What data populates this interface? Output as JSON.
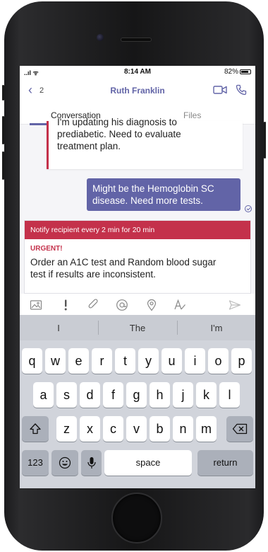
{
  "status_bar": {
    "signal": "..ıl ᯤ",
    "time": "8:14 AM",
    "battery": "82%"
  },
  "header": {
    "back_arrow": "‹",
    "back_count": "2",
    "title": "Ruth Franklin",
    "video_icon": "video-camera-icon",
    "call_icon": "phone-icon"
  },
  "tabs": [
    {
      "label": "Conversation",
      "active": true
    },
    {
      "label": "Files",
      "active": false
    }
  ],
  "messages": [
    {
      "lines": [
        "I'm updating his diagnosis to",
        "prediabetic. Need to evaluate",
        "treatment plan."
      ],
      "incoming": true
    },
    {
      "lines": [
        "Might be the Hemoglobin SC",
        "disease. Need more tests."
      ],
      "incoming": false
    }
  ],
  "compose": {
    "notify_text": "Notify recipient every 2 min for 20 min",
    "urgent_label": "URGENT!",
    "lines": [
      "Order an A1C test and Random blood sugar",
      "test if results are inconsistent."
    ]
  },
  "toolbar_icons": [
    "image-icon",
    "exclamation-icon",
    "paperclip-icon",
    "mention-icon",
    "location-pin-icon",
    "format-text-icon",
    "send-icon"
  ],
  "keyboard": {
    "suggestions": [
      "I",
      "The",
      "I'm"
    ],
    "row1": [
      "q",
      "w",
      "e",
      "r",
      "t",
      "y",
      "u",
      "i",
      "o",
      "p"
    ],
    "row2": [
      "a",
      "s",
      "d",
      "f",
      "g",
      "h",
      "j",
      "k",
      "l"
    ],
    "row3": [
      "z",
      "x",
      "c",
      "v",
      "b",
      "n",
      "m"
    ],
    "numbers_key": "123",
    "space_key": "space",
    "return_key": "return"
  },
  "colors": {
    "accent": "#6264a7",
    "urgent": "#c4314b"
  }
}
